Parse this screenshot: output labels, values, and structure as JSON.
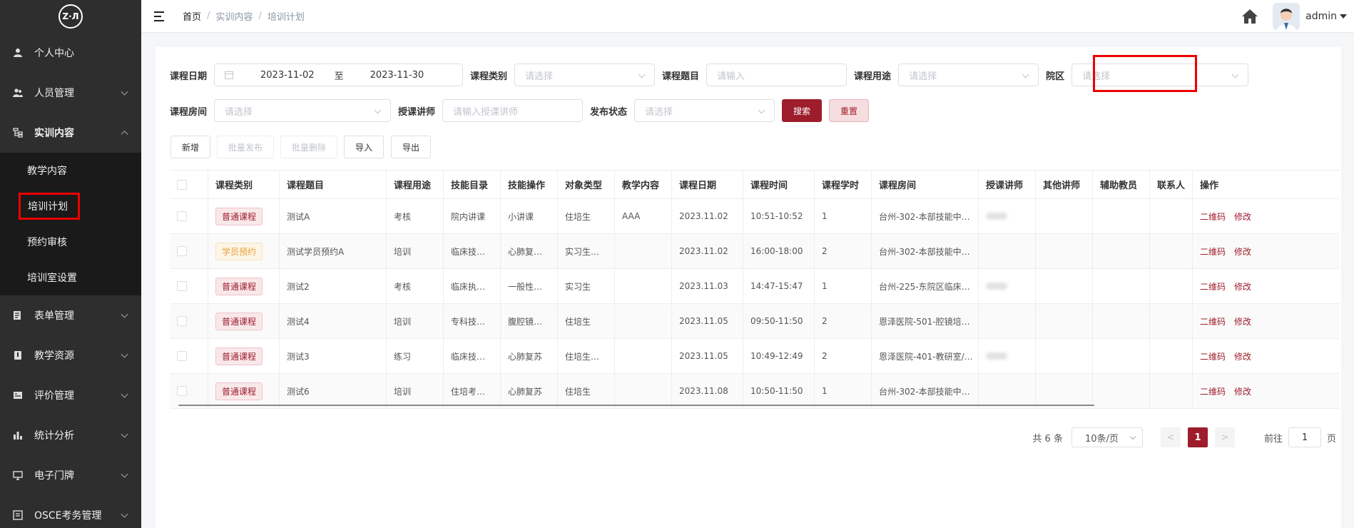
{
  "sidebar": {
    "logo": "Z·Л",
    "items": [
      {
        "label": "个人中心",
        "icon": "user-icon"
      },
      {
        "label": "人员管理",
        "icon": "users-icon"
      },
      {
        "label": "实训内容",
        "icon": "tree-icon"
      },
      {
        "label": "表单管理",
        "icon": "form-icon"
      },
      {
        "label": "教学资源",
        "icon": "book-icon"
      },
      {
        "label": "评价管理",
        "icon": "evaluate-icon"
      },
      {
        "label": "统计分析",
        "icon": "bar-chart-icon"
      },
      {
        "label": "电子门牌",
        "icon": "monitor-icon"
      },
      {
        "label": "OSCE考务管理",
        "icon": "exam-icon"
      }
    ],
    "sub_items": [
      "教学内容",
      "培训计划",
      "预约审核",
      "培训室设置"
    ]
  },
  "header": {
    "breadcrumb": [
      "首页",
      "实训内容",
      "培训计划"
    ],
    "user": "admin"
  },
  "filters": {
    "date_label": "课程日期",
    "date_start": "2023-11-02",
    "date_sep": "至",
    "date_end": "2023-11-30",
    "category_label": "课程类别",
    "category_ph": "请选择",
    "topic_label": "课程题目",
    "topic_ph": "请输入",
    "usage_label": "课程用途",
    "usage_ph": "请选择",
    "campus_label": "院区",
    "campus_ph": "请选择",
    "room_label": "课程房间",
    "room_ph": "请选择",
    "teacher_label": "授课讲师",
    "teacher_ph": "请输入授课讲师",
    "status_label": "发布状态",
    "status_ph": "请选择",
    "search": "搜索",
    "reset": "重置"
  },
  "toolbar": {
    "add": "新增",
    "batch_publish": "批量发布",
    "batch_delete": "批量删除",
    "import": "导入",
    "export": "导出"
  },
  "table": {
    "headers": [
      "课程类别",
      "课程题目",
      "课程用途",
      "技能目录",
      "技能操作",
      "对象类型",
      "教学内容",
      "课程日期",
      "课程时间",
      "课程学时",
      "课程房间",
      "授课讲师",
      "其他讲师",
      "辅助教员",
      "联系人",
      "操作"
    ],
    "rows": [
      {
        "category": "普通课程",
        "tag": "normal",
        "topic": "测试A",
        "usage": "考核",
        "skill_dir": "院内讲课",
        "skill_op": "小讲课",
        "target": "住培生",
        "content": "AAA",
        "date": "2023.11.02",
        "time": "10:51-10:52",
        "hours": "1",
        "room": "台州-302-本部技能中…",
        "teacher_blur": true
      },
      {
        "category": "学员预约",
        "tag": "student",
        "topic": "测试学员预约A",
        "usage": "培训",
        "skill_dir": "临床技…",
        "skill_op": "心肺复…",
        "target": "实习生…",
        "content": "",
        "date": "2023.11.02",
        "time": "16:00-18:00",
        "hours": "2",
        "room": "台州-302-本部技能中…",
        "teacher_blur": false
      },
      {
        "category": "普通课程",
        "tag": "normal",
        "topic": "测试2",
        "usage": "考核",
        "skill_dir": "临床执…",
        "skill_op": "一般性…",
        "target": "实习生",
        "content": "",
        "date": "2023.11.03",
        "time": "14:47-15:47",
        "hours": "1",
        "room": "台州-225-东院区临床…",
        "teacher_blur": true
      },
      {
        "category": "普通课程",
        "tag": "normal",
        "topic": "测试4",
        "usage": "培训",
        "skill_dir": "专科技…",
        "skill_op": "腹腔镜…",
        "target": "住培生",
        "content": "",
        "date": "2023.11.05",
        "time": "09:50-11:50",
        "hours": "2",
        "room": "恩泽医院-501-腔镜培…",
        "teacher_blur": false
      },
      {
        "category": "普通课程",
        "tag": "normal",
        "topic": "测试3",
        "usage": "练习",
        "skill_dir": "临床技…",
        "skill_op": "心肺复苏",
        "target": "住培生…",
        "content": "",
        "date": "2023.11.05",
        "time": "10:49-12:49",
        "hours": "2",
        "room": "恩泽医院-401-教研室/…",
        "teacher_blur": true
      },
      {
        "category": "普通课程",
        "tag": "normal",
        "topic": "测试6",
        "usage": "培训",
        "skill_dir": "住培考…",
        "skill_op": "心肺复苏",
        "target": "住培生",
        "content": "",
        "date": "2023.11.08",
        "time": "10:50-11:50",
        "hours": "1",
        "room": "台州-302-本部技能中…",
        "teacher_blur": false
      }
    ],
    "op_qr": "二维码",
    "op_edit": "修改"
  },
  "pagination": {
    "total": "共 6 条",
    "page_size": "10条/页",
    "prev": "<",
    "current": "1",
    "next": ">",
    "goto": "前往",
    "goto_value": "1",
    "page_unit": "页"
  },
  "colors": {
    "primary": "#9e1d2c",
    "sidebar": "#2e2e2e",
    "highlight": "#ee0000"
  }
}
